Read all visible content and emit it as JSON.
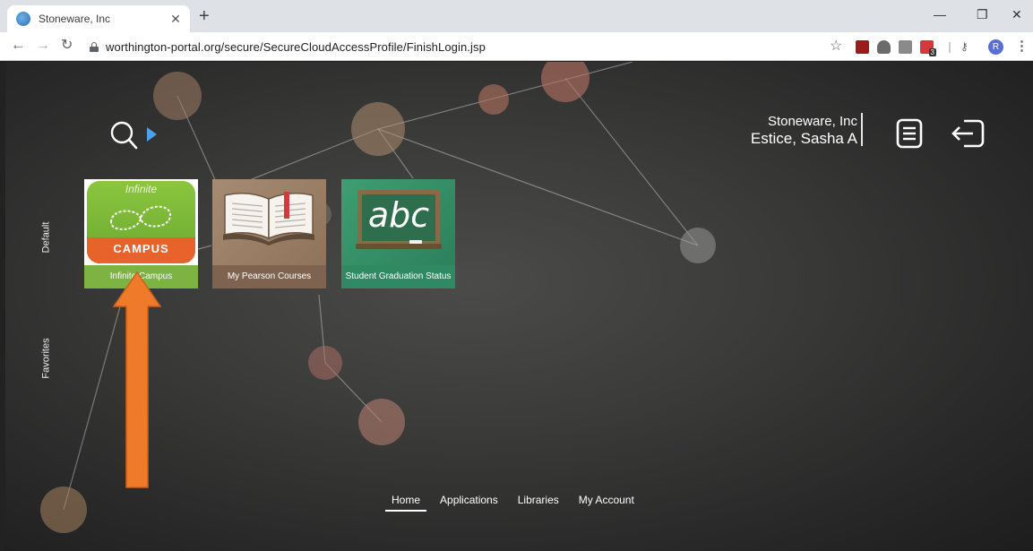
{
  "browser": {
    "tab_title": "Stoneware, Inc",
    "url": "worthington-portal.org/secure/SecureCloudAccessProfile/FinishLogin.jsp",
    "avatar_letter": "R",
    "extension_badge": "3"
  },
  "header": {
    "org_name": "Stoneware, Inc",
    "user_name": "Estice, Sasha A"
  },
  "side_tabs": [
    "Default",
    "Favorites"
  ],
  "tiles": [
    {
      "label": "Infinite Campus",
      "logo_top": "Infinite",
      "logo_bottom": "CAMPUS",
      "color": "#7cb342"
    },
    {
      "label": "My Pearson Courses",
      "color": "#9a7d64"
    },
    {
      "label": "Student Graduation Status",
      "logo_text": "abc",
      "color": "#2f8a63"
    }
  ],
  "bottom_nav": [
    {
      "label": "Home",
      "active": true
    },
    {
      "label": "Applications",
      "active": false
    },
    {
      "label": "Libraries",
      "active": false
    },
    {
      "label": "My Account",
      "active": false
    }
  ],
  "colors": {
    "accent_arrow": "#ef7b2a",
    "search_play": "#4aa3e8"
  }
}
